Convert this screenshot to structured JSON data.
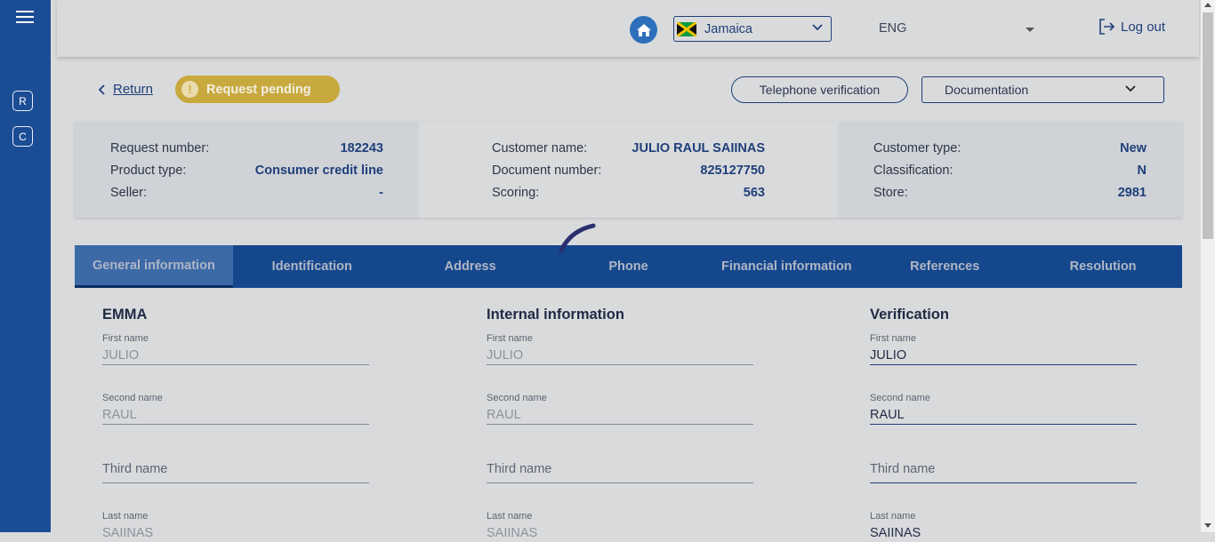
{
  "sidebar": {
    "btn_r": "R",
    "btn_c": "C"
  },
  "topbar": {
    "country": "Jamaica",
    "language": "ENG",
    "logout": "Log out"
  },
  "actions": {
    "return": "Return",
    "status": "Request pending",
    "status_icon": "!",
    "telephone_verification": "Telephone verification",
    "documentation": "Documentation"
  },
  "summary": {
    "left": [
      {
        "k": "Request number:",
        "v": "182243"
      },
      {
        "k": "Product type:",
        "v": "Consumer credit line"
      },
      {
        "k": "Seller:",
        "v": "-"
      }
    ],
    "mid": [
      {
        "k": "Customer name:",
        "v": "JULIO RAUL SAIINAS"
      },
      {
        "k": "Document number:",
        "v": "825127750"
      },
      {
        "k": "Scoring:",
        "v": "563"
      }
    ],
    "right": [
      {
        "k": "Customer type:",
        "v": "New"
      },
      {
        "k": "Classification:",
        "v": "N"
      },
      {
        "k": "Store:",
        "v": "2981"
      }
    ]
  },
  "tabs": [
    "General information",
    "Identification",
    "Address",
    "Phone",
    "Financial information",
    "References",
    "Resolution"
  ],
  "columns": [
    {
      "title": "EMMA",
      "first_label": "First name",
      "first": "JULIO",
      "second_label": "Second name",
      "second": "RAUL",
      "third_ph": "Third name",
      "last_label": "Last name",
      "last": "SAIINAS"
    },
    {
      "title": "Internal information",
      "first_label": "First name",
      "first": "JULIO",
      "second_label": "Second name",
      "second": "RAUL",
      "third_ph": "Third name",
      "last_label": "Last name",
      "last": "SAIINAS"
    },
    {
      "title": "Verification",
      "first_label": "First name",
      "first": "JULIO",
      "second_label": "Second name",
      "second": "RAUL",
      "third_ph": "Third name",
      "last_label": "Last name",
      "last": "SAIINAS"
    }
  ],
  "colors": {
    "sidebar": "#1b4d94",
    "accent": "#1f3f7a",
    "pending": "#c8a93e",
    "tabs": "#15478d"
  }
}
